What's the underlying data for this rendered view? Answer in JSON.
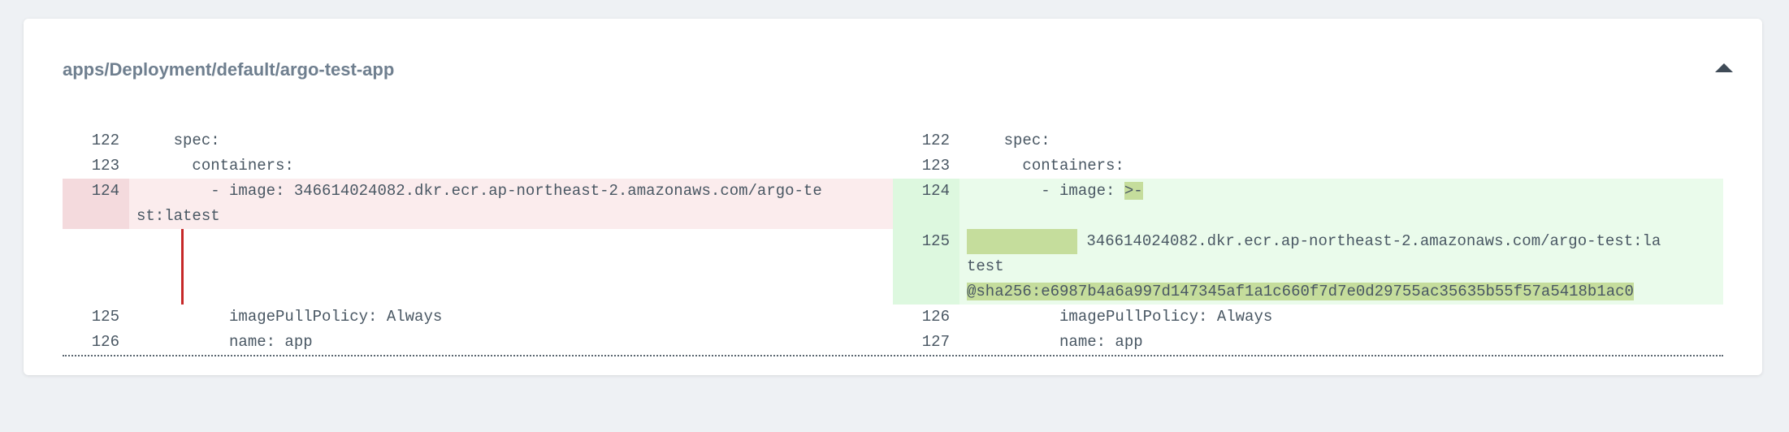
{
  "resource": {
    "title": "apps/Deployment/default/argo-test-app",
    "collapse_icon": "caret-up-icon"
  },
  "diff": {
    "left": {
      "l1": {
        "num": "122",
        "text": "    spec:"
      },
      "l2": {
        "num": "123",
        "text": "      containers:"
      },
      "l3": {
        "num": "124",
        "text1": "        - image: 346614024082.dkr.ecr.ap-northeast-2.amazonaws.com/argo-te",
        "text2": "st:latest"
      },
      "l4": {
        "num": "125",
        "text": "          imagePullPolicy: Always"
      },
      "l5": {
        "num": "126",
        "text": "          name: app"
      }
    },
    "right": {
      "l1": {
        "num": "122",
        "text": "    spec:"
      },
      "l2": {
        "num": "123",
        "text": "      containers:"
      },
      "l3": {
        "num": "124",
        "text": "        - image: ",
        "hl": ">-"
      },
      "l4": {
        "num": "125",
        "text1": " 346614024082.dkr.ecr.ap-northeast-2.amazonaws.com/argo-test:la",
        "text2": "test",
        "sha": "@sha256:e6987b4a6a997d147345af1a1c660f7d7e0d29755ac35635b55f57a5418b1ac0"
      },
      "l5": {
        "num": "126",
        "text": "          imagePullPolicy: Always"
      },
      "l6": {
        "num": "127",
        "text": "          name: app"
      }
    }
  },
  "colors": {
    "removed_gutter": "#f4dadd",
    "removed_code": "#fbeced",
    "added_gutter": "#ddf8df",
    "added_code": "#eafbeb",
    "highlight": "#c5dd9c",
    "marker": "#c62828"
  }
}
